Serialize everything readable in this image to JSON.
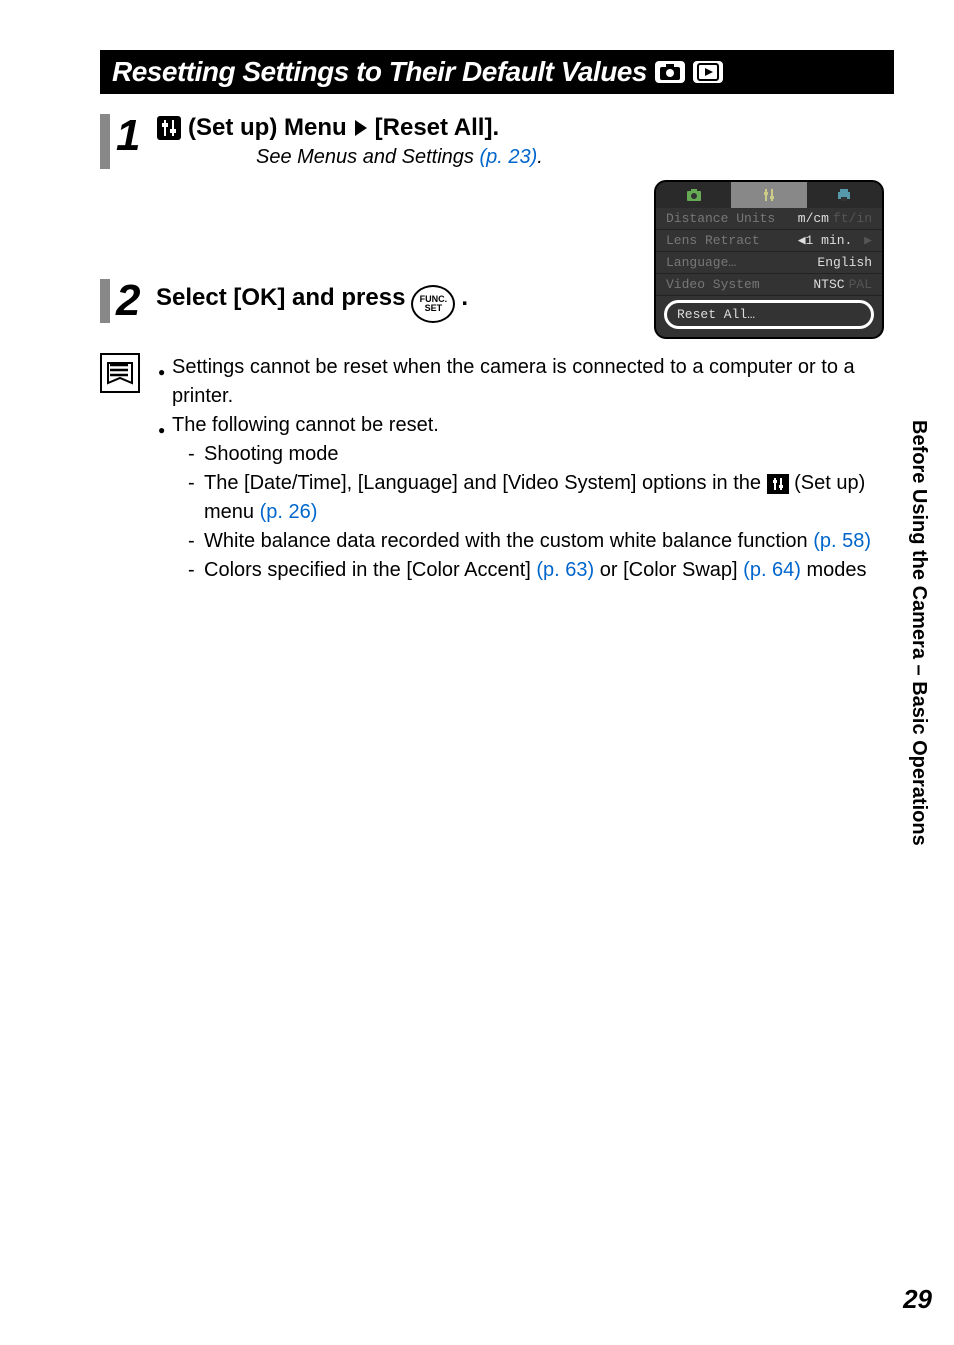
{
  "title": "Resetting Settings to Their Default Values",
  "step1": {
    "heading_prefix": "(Set up) Menu",
    "heading_suffix": "[Reset All].",
    "substep_prefix": "See Menus and Settings ",
    "substep_link": "(p. 23)",
    "substep_period": "."
  },
  "step2": {
    "heading": "Select [OK] and press",
    "heading_period": "."
  },
  "func_button": "FUNC.\nSET",
  "screenshot": {
    "row1": {
      "label": "Distance Units",
      "val1": "m/cm",
      "val2": "ft/in"
    },
    "row2": {
      "label": "Lens Retract",
      "val": "◀1 min.",
      "arrow": "▶"
    },
    "row3": {
      "label": "Language…",
      "val": "English"
    },
    "row4": {
      "label": "Video System",
      "val1": "NTSC",
      "val2": "PAL"
    },
    "reset": "Reset All…"
  },
  "notes": {
    "b1": "Settings cannot be reset when the camera is connected to a computer or to a printer.",
    "b2": "The following cannot be reset.",
    "s1": "Shooting mode",
    "s2a": "The [Date/Time], [Language] and [Video System] options in the ",
    "s2b": " (Set up) menu ",
    "s2link": "(p. 26)",
    "s3a": "White balance data recorded with the custom white balance function ",
    "s3link": "(p. 58)",
    "s4a": "Colors specified in the [Color Accent] ",
    "s4link1": "(p. 63)",
    "s4b": " or [Color Swap] ",
    "s4link2": "(p. 64)",
    "s4c": " modes"
  },
  "sidebar": "Before Using the Camera – Basic Operations",
  "page_number": "29"
}
